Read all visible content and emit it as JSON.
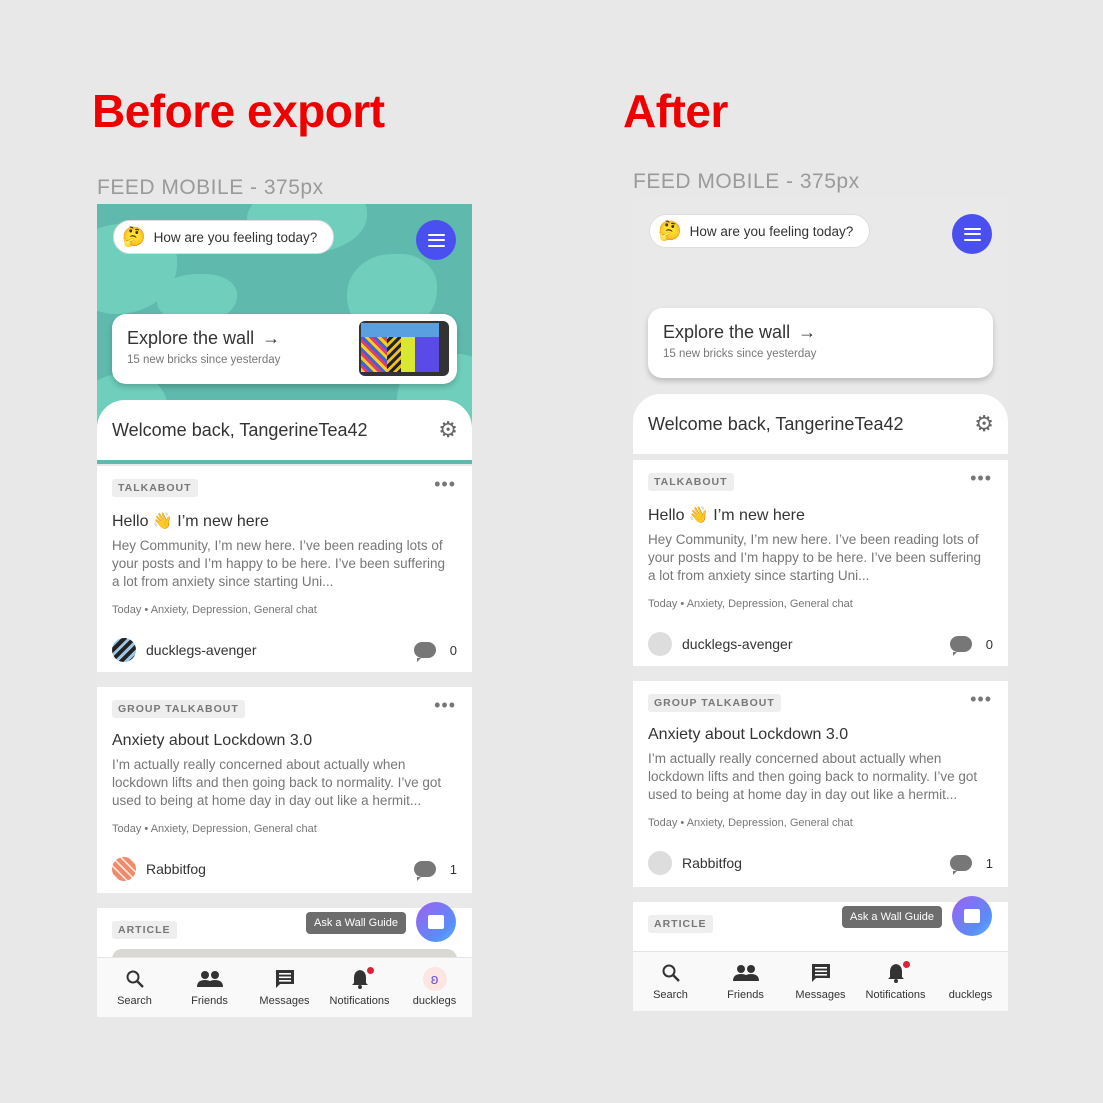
{
  "headings": {
    "before": "Before export",
    "after": "After"
  },
  "frames": [
    {
      "label": "FEED MOBILE - 375px",
      "feeling_prompt": "How are you feeling today?",
      "feeling_emoji": "🤔",
      "explore": {
        "title": "Explore the wall",
        "arrow": "→",
        "subtitle": "15 new bricks since yesterday"
      },
      "welcome": "Welcome back, TangerineTea42",
      "posts": [
        {
          "tag": "TALKABOUT",
          "title": "Hello 👋 I’m new here",
          "body": "Hey Community, I’m new here. I’ve been reading lots of your posts and I’m happy to be here. I’ve been suffering a lot from anxiety since starting Uni...",
          "meta": "Today • Anxiety, Depression, General chat",
          "author": "ducklegs-avenger",
          "comments": "0"
        },
        {
          "tag": "GROUP TALKABOUT",
          "title": "Anxiety about Lockdown 3.0",
          "body": "I’m actually really concerned about actually when lockdown lifts and then going back to normality. I’ve got used to being at home day in day out like a hermit...",
          "meta": "Today • Anxiety, Depression, General chat",
          "author": "Rabbitfog",
          "comments": "1"
        }
      ],
      "article_tag": "ARTICLE",
      "guide_tip": "Ask a Wall Guide",
      "nav": [
        "Search",
        "Friends",
        "Messages",
        "Notifications",
        "ducklegs"
      ]
    },
    {
      "label": "FEED MOBILE - 375px",
      "feeling_prompt": "How are you feeling today?",
      "feeling_emoji": "🤔",
      "explore": {
        "title": "Explore the wall",
        "arrow": "→",
        "subtitle": "15 new bricks since yesterday"
      },
      "welcome": "Welcome back, TangerineTea42",
      "posts": [
        {
          "tag": "TALKABOUT",
          "title": "Hello 👋 I’m new here",
          "body": "Hey Community, I’m new here. I’ve been reading lots of your posts and I’m happy to be here. I’ve been suffering a lot from anxiety since starting Uni...",
          "meta": "Today • Anxiety, Depression, General chat",
          "author": "ducklegs-avenger",
          "comments": "0"
        },
        {
          "tag": "GROUP TALKABOUT",
          "title": "Anxiety about Lockdown 3.0",
          "body": "I’m actually really concerned about actually when lockdown lifts and then going back to normality. I’ve got used to being at home day in day out like a hermit...",
          "meta": "Today • Anxiety, Depression, General chat",
          "author": "Rabbitfog",
          "comments": "1"
        }
      ],
      "article_tag": "ARTICLE",
      "guide_tip": "Ask a Wall Guide",
      "nav": [
        "Search",
        "Friends",
        "Messages",
        "Notifications",
        "ducklegs"
      ]
    }
  ],
  "colors": {
    "heading": "#ee0000",
    "accent": "#4a4ff0",
    "hero_bg": "#5fb9ad",
    "notification_dot": "#e02030"
  }
}
